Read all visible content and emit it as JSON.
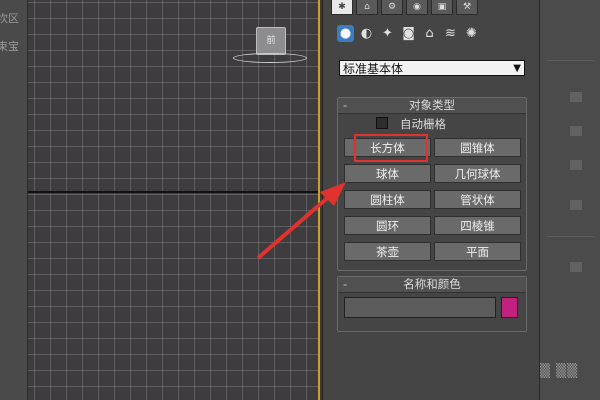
{
  "left_strip": {
    "frag1": "坎区",
    "frag2": "束宝"
  },
  "viewport": {
    "viewcube_label": "前"
  },
  "panel": {
    "tabs": [
      "✱",
      "⌂",
      "⚙",
      "◉",
      "▣",
      "⚒"
    ],
    "icons": [
      "sphere-icon",
      "shapes-icon",
      "light-icon",
      "camera-icon",
      "helper-icon",
      "spacewarp-icon",
      "systems-icon"
    ],
    "dropdown_value": "标准基本体",
    "object_type": {
      "title": "对象类型",
      "minus": "-",
      "autogrid_label": "自动栅格",
      "buttons": [
        "长方体",
        "圆锥体",
        "球体",
        "几何球体",
        "圆柱体",
        "管状体",
        "圆环",
        "四棱锥",
        "茶壶",
        "平面"
      ]
    },
    "name_color": {
      "title": "名称和颜色",
      "minus": "-",
      "name_value": "",
      "swatch_color": "#c2227e"
    }
  },
  "colors": {
    "annotation_red": "#e0322e",
    "viewport_border": "#c9a227"
  }
}
